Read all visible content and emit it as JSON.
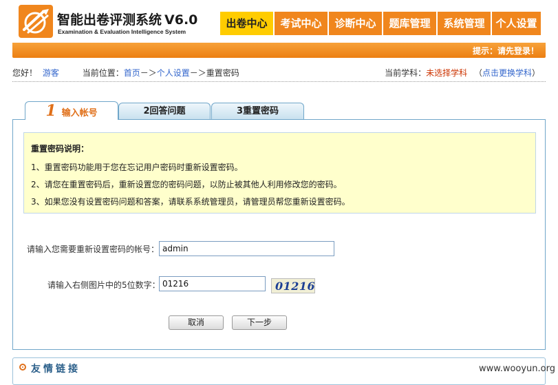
{
  "header": {
    "title": "智能出卷评测系统",
    "version": "V6.0",
    "subtitle": "Examination & Evaluation Intelligence System",
    "nav": [
      {
        "label": "出卷中心",
        "active": true
      },
      {
        "label": "考试中心",
        "active": false
      },
      {
        "label": "诊断中心",
        "active": false
      },
      {
        "label": "题库管理",
        "active": false
      },
      {
        "label": "系统管理",
        "active": false
      },
      {
        "label": "个人设置",
        "active": false
      }
    ]
  },
  "hint_bar": {
    "text": "提示：请先登录！"
  },
  "infobar": {
    "greeting": "您好！",
    "user": "游客",
    "location_label": "当前位置：",
    "crumb_home": "首页",
    "arrow1": "－＞",
    "crumb_personal": "个人设置",
    "arrow2": "－＞",
    "crumb_current": "重置密码",
    "subject_label": "当前学科：",
    "subject_value": "未选择学科",
    "change_subject": "点击更换学科",
    "paren_open": "（",
    "paren_close": "）"
  },
  "tabs": [
    {
      "num": "1",
      "label": "输入帐号",
      "active": true
    },
    {
      "num": "2",
      "label": "回答问题",
      "active": false
    },
    {
      "num": "3",
      "label": "重置密码",
      "active": false
    }
  ],
  "notice": {
    "title": "重置密码说明：",
    "lines": [
      "1、重置密码功能用于您在忘记用户密码时重新设置密码。",
      "2、请您在重置密码后，重新设置您的密码问题，以防止被其他人利用修改您的密码。",
      "3、如果您没有设置密码问题和答案，请联系系统管理员，请管理员帮您重新设置密码。"
    ]
  },
  "form": {
    "account_label": "请输入您需要重新设置密码的帐号：",
    "account_value": "admin",
    "captcha_label": "请输入右侧图片中的5位数字：",
    "captcha_value": "01216",
    "captcha_image_text": "01216",
    "cancel_label": "取消",
    "next_label": "下一步"
  },
  "links": {
    "title": "友情链接"
  },
  "watermark": "www.wooyun.org",
  "colors": {
    "orange": "#f0861d",
    "active_nav": "#ffcc00",
    "link": "#3366cc",
    "notice_bg": "#ffffcc"
  }
}
